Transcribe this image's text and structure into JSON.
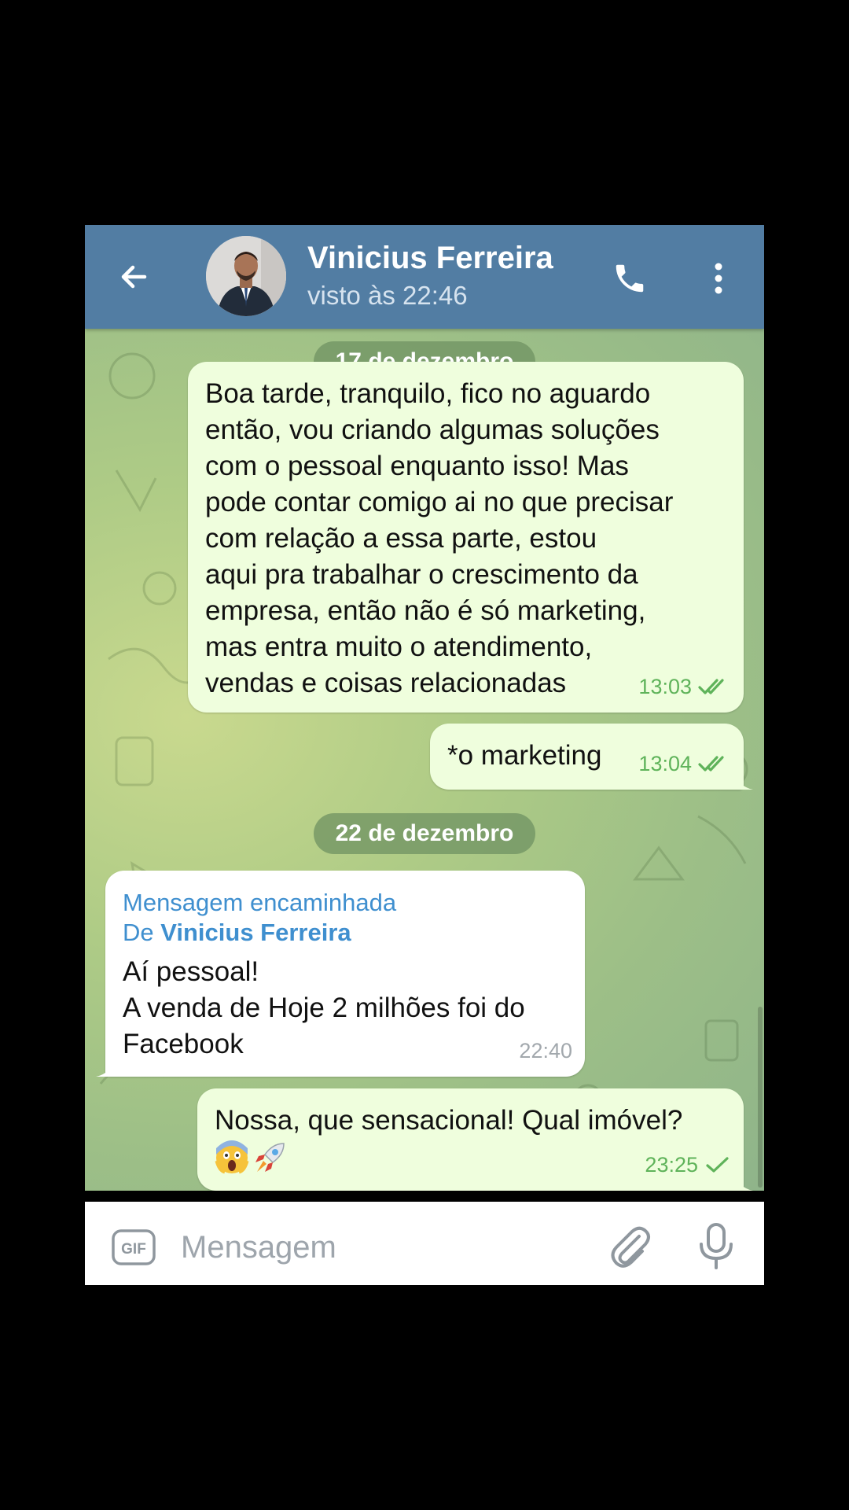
{
  "header": {
    "contact_name": "Vinicius Ferreira",
    "status": "visto às 22:46",
    "color": "#527da3"
  },
  "chat": {
    "dates": [
      "17 de dezembro",
      "22 de dezembro"
    ],
    "messages": [
      {
        "direction": "outgoing",
        "text": "Boa tarde, tranquilo, fico no aguardo\nentão, vou criando algumas soluções\ncom o pessoal enquanto isso! Mas\npode contar comigo ai no que precisar\ncom relação a essa parte, estou\naqui pra trabalhar o crescimento da\nempresa, então não é só marketing,\nmas entra muito o atendimento,\nvendas e coisas relacionadas",
        "time": "13:03",
        "status": "read"
      },
      {
        "direction": "outgoing",
        "text": "*o marketing",
        "time": "13:04",
        "status": "read"
      },
      {
        "direction": "incoming",
        "forward_label": "Mensagem encaminhada",
        "forward_from_prefix": "De",
        "forward_from_name": "Vinicius Ferreira",
        "text": "Aí pessoal!\nA venda de Hoje 2 milhões foi do\nFacebook",
        "time": "22:40"
      },
      {
        "direction": "outgoing",
        "text": "Nossa, que sensacional! Qual imóvel?",
        "emoji": [
          "face-screaming",
          "rocket"
        ],
        "time": "23:25",
        "status": "sent"
      }
    ]
  },
  "input": {
    "placeholder": "Mensagem",
    "gif_label": "GIF"
  },
  "colors": {
    "outgoing_bubble": "#effedd",
    "incoming_bubble": "#ffffff",
    "check_green": "#5fb35a",
    "forward_blue": "#3f8fcf"
  }
}
